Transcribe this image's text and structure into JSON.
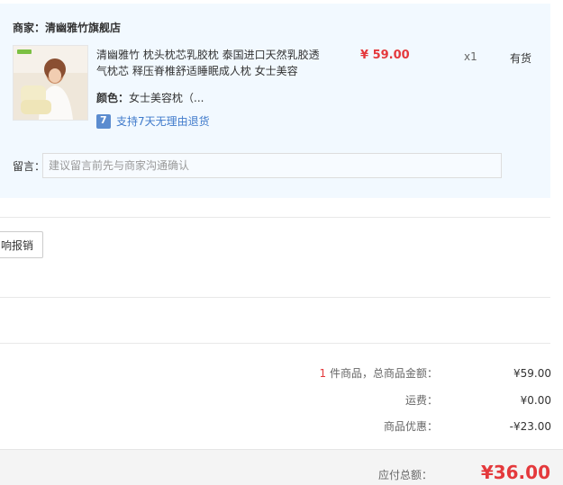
{
  "store": {
    "merchant_label": "商家：",
    "merchant_name": "清幽雅竹旗舰店"
  },
  "product": {
    "name": "清幽雅竹 枕头枕芯乳胶枕 泰国进口天然乳胶透气枕芯 释压脊椎舒适睡眠成人枕 女士美容",
    "price": "¥ 59.00",
    "quantity": "x1",
    "stock": "有货",
    "color_label": "颜色：",
    "color_value": "女士美容枕（...",
    "return_policy": "支持7天无理由退货"
  },
  "message": {
    "label": "留言：",
    "placeholder": "建议留言前先与商家沟通确认"
  },
  "actions": {
    "reimburse": "响报销"
  },
  "summary": {
    "item_count": "1",
    "goods_label": "件商品，总商品金额：",
    "goods_value": "¥59.00",
    "shipping_label": "运费：",
    "shipping_value": "¥0.00",
    "discount_label": "商品优惠：",
    "discount_value": "-¥23.00",
    "total_label": "应付总额：",
    "total_value": "¥36.00"
  },
  "colors": {
    "accent_red": "#e4393c",
    "link_blue": "#3f7acb",
    "panel_bg": "#f2f9ff"
  }
}
